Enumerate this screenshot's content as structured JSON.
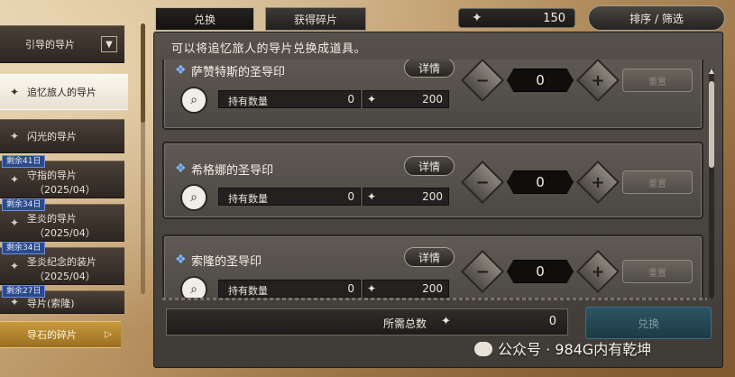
{
  "sidebar": {
    "items": [
      {
        "label": "引导的导片",
        "sub": "",
        "badge": ""
      },
      {
        "label": "追忆旅人的导片",
        "sub": "",
        "badge": ""
      },
      {
        "label": "闪光的导片",
        "sub": "",
        "badge": ""
      },
      {
        "label": "守指的导片",
        "sub": "（2025/04）",
        "badge": "剩余41日"
      },
      {
        "label": "圣炎的导片",
        "sub": "（2025/04）",
        "badge": "剩余34日"
      },
      {
        "label": "圣炎纪念的装片",
        "sub": "（2025/04）",
        "badge": "剩余34日"
      },
      {
        "label": "导片(索隆)",
        "sub": "",
        "badge": "剩余27日"
      },
      {
        "label": "导石的碎片",
        "sub": "",
        "badge": ""
      }
    ],
    "chevron": "▼",
    "arrow": "▷"
  },
  "tabs": [
    {
      "label": "兑换"
    },
    {
      "label": "获得碎片"
    }
  ],
  "currency": {
    "icon": "✦",
    "value": "150"
  },
  "sort_label": "排序 / 筛选",
  "description": "可以将追忆旅人的导片兑换成道具。",
  "cards": [
    {
      "name": "萨赞特斯的圣导印",
      "detail_label": "详情",
      "hold_label": "持有数量",
      "hold_value": "0",
      "cost": "200",
      "qty": "0",
      "reset_label": "重置"
    },
    {
      "name": "希格娜的圣导印",
      "detail_label": "详情",
      "hold_label": "持有数量",
      "hold_value": "0",
      "cost": "200",
      "qty": "0",
      "reset_label": "重置"
    },
    {
      "name": "索隆的圣导印",
      "detail_label": "详情",
      "hold_label": "持有数量",
      "hold_value": "0",
      "cost": "200",
      "qty": "0",
      "reset_label": "重置"
    }
  ],
  "total": {
    "label": "所需总数",
    "value": "0"
  },
  "exchange_label": "兑换",
  "watermark": "公众号 · 984G内有乾坤",
  "colors": {
    "accent_blue": "#2c4a8a",
    "gold": "#c89a3c",
    "panel": "#55504a"
  }
}
